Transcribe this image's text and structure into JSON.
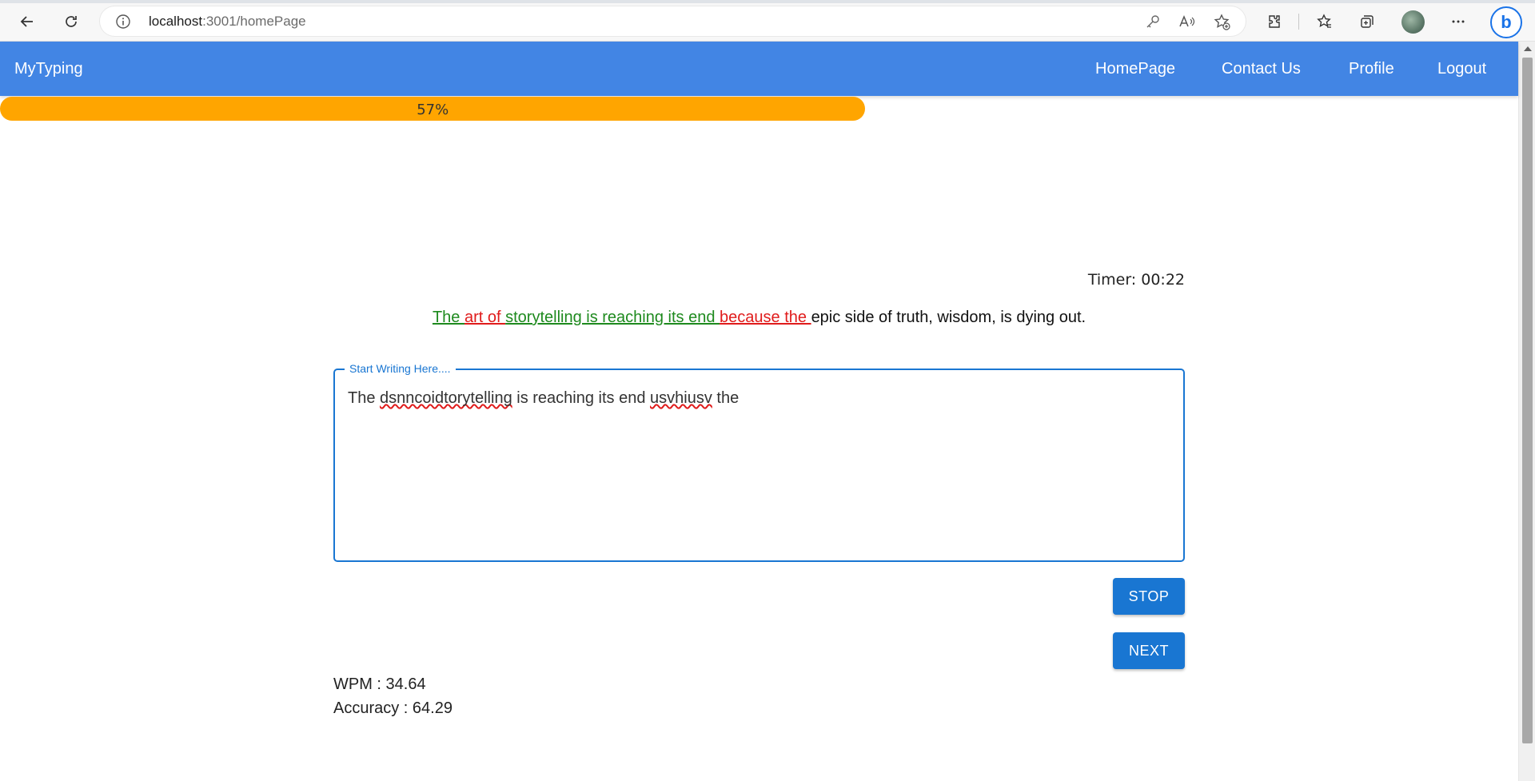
{
  "browser": {
    "url_host": "localhost",
    "url_rest": ":3001/homePage",
    "icons": [
      "back-icon",
      "refresh-icon",
      "info-icon",
      "key-icon",
      "read-aloud-icon",
      "add-favorite-icon",
      "extensions-icon",
      "favorites-icon",
      "collections-icon",
      "profile-avatar",
      "more-icon",
      "bing-icon"
    ]
  },
  "app": {
    "brand": "MyTyping",
    "nav": [
      "HomePage",
      "Contact Us",
      "Profile",
      "Logout"
    ],
    "accent_color": "#4285e4",
    "button_color": "#1976d2"
  },
  "progress": {
    "value_percent": 57,
    "label": "57%",
    "color": "#ffa500"
  },
  "test": {
    "timer": "Timer: 00:22",
    "sentence_segments": [
      {
        "text": "The ",
        "state": "correct"
      },
      {
        "text": "art of ",
        "state": "wrong"
      },
      {
        "text": "storytelling is reaching its end ",
        "state": "correct"
      },
      {
        "text": "because the ",
        "state": "wrong"
      },
      {
        "text": "epic side of truth, wisdom, is dying out.",
        "state": "pending"
      }
    ],
    "input_label": "Start Writing Here....",
    "input_segments": [
      {
        "text": "The ",
        "misspelled": false
      },
      {
        "text": "dsnncoidtorytelling",
        "misspelled": true
      },
      {
        "text": " is reaching its end ",
        "misspelled": false
      },
      {
        "text": "usvhiusv",
        "misspelled": true
      },
      {
        "text": " the",
        "misspelled": false
      }
    ],
    "stop_label": "STOP",
    "next_label": "NEXT",
    "wpm_text": "WPM : 34.64",
    "accuracy_text": "Accuracy : 64.29"
  }
}
